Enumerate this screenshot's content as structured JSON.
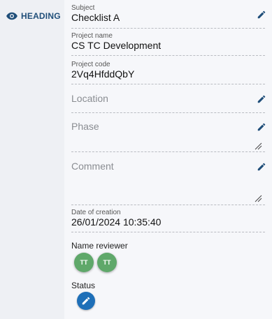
{
  "sidebar": {
    "heading_label": "HEADING",
    "heading_icon": "eye-icon"
  },
  "fields": {
    "subject": {
      "label": "Subject",
      "value": "Checklist A"
    },
    "project_name": {
      "label": "Project name",
      "value": "CS TC Development"
    },
    "project_code": {
      "label": "Project code",
      "value": "2Vq4HfddQbY"
    },
    "location": {
      "placeholder": "Location"
    },
    "phase": {
      "placeholder": "Phase"
    },
    "comment": {
      "placeholder": "Comment"
    },
    "date_of_creation": {
      "label": "Date of creation",
      "value": "26/01/2024 10:35:40"
    }
  },
  "reviewers": {
    "label": "Name reviewer",
    "avatars": [
      "TT",
      "TT"
    ]
  },
  "status": {
    "label": "Status"
  },
  "colors": {
    "accent": "#1e6fb8",
    "heading": "#1f4e79",
    "avatar": "#5fa86a"
  }
}
